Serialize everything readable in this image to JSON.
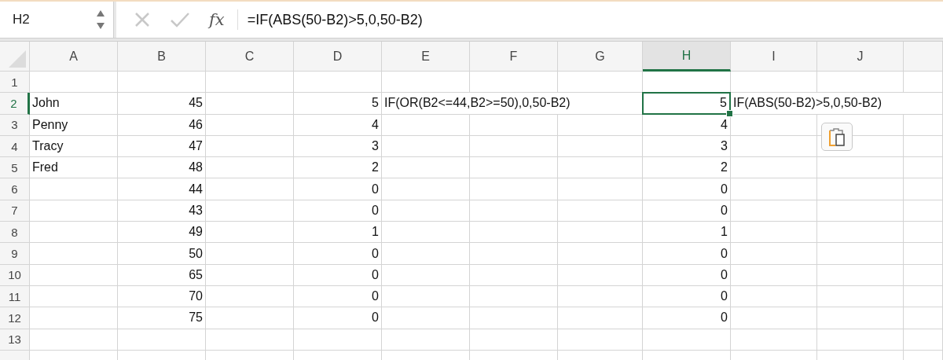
{
  "formula_bar": {
    "name_box": "H2",
    "fx_label": "fx",
    "formula": "=IF(ABS(50-B2)>5,0,50-B2)"
  },
  "columns": [
    {
      "label": "A",
      "selected": false
    },
    {
      "label": "B",
      "selected": false
    },
    {
      "label": "C",
      "selected": false
    },
    {
      "label": "D",
      "selected": false
    },
    {
      "label": "E",
      "selected": false
    },
    {
      "label": "F",
      "selected": false
    },
    {
      "label": "G",
      "selected": false
    },
    {
      "label": "H",
      "selected": true
    },
    {
      "label": "I",
      "selected": false
    },
    {
      "label": "J",
      "selected": false
    }
  ],
  "rows": [
    {
      "label": "1",
      "selected": false
    },
    {
      "label": "2",
      "selected": true,
      "cells": [
        {
          "value": "John",
          "kind": "text",
          "selected": false
        },
        {
          "value": "45",
          "kind": "number",
          "selected": false
        },
        {
          "kind": "empty",
          "selected": false
        },
        {
          "value": "5",
          "kind": "number",
          "selected": false
        },
        {
          "value": "IF(OR(B2<=44,B2>=50),0,50-B2)",
          "kind": "text",
          "selected": false
        },
        {
          "kind": "empty",
          "selected": false
        },
        {
          "kind": "empty",
          "selected": false
        },
        {
          "value": "5",
          "kind": "number",
          "selected": true
        },
        {
          "value": "IF(ABS(50-B2)>5,0,50-B2)",
          "kind": "text",
          "selected": false
        },
        {
          "kind": "empty",
          "selected": false
        }
      ]
    },
    {
      "label": "3",
      "selected": false,
      "cells": [
        {
          "value": "Penny",
          "kind": "text",
          "selected": false
        },
        {
          "value": "46",
          "kind": "number",
          "selected": false
        },
        {
          "kind": "empty",
          "selected": false
        },
        {
          "value": "4",
          "kind": "number",
          "selected": false
        },
        {
          "kind": "empty",
          "selected": false
        },
        {
          "kind": "empty",
          "selected": false
        },
        {
          "kind": "empty",
          "selected": false
        },
        {
          "value": "4",
          "kind": "number",
          "selected": false
        },
        {
          "kind": "empty",
          "selected": false
        },
        {
          "kind": "empty",
          "selected": false
        }
      ]
    },
    {
      "label": "4",
      "selected": false,
      "cells": [
        {
          "value": "Tracy",
          "kind": "text",
          "selected": false
        },
        {
          "value": "47",
          "kind": "number",
          "selected": false
        },
        {
          "kind": "empty",
          "selected": false
        },
        {
          "value": "3",
          "kind": "number",
          "selected": false
        },
        {
          "kind": "empty",
          "selected": false
        },
        {
          "kind": "empty",
          "selected": false
        },
        {
          "kind": "empty",
          "selected": false
        },
        {
          "value": "3",
          "kind": "number",
          "selected": false
        },
        {
          "kind": "empty",
          "selected": false
        },
        {
          "kind": "empty",
          "selected": false
        }
      ]
    },
    {
      "label": "5",
      "selected": false,
      "cells": [
        {
          "value": "Fred",
          "kind": "text",
          "selected": false
        },
        {
          "value": "48",
          "kind": "number",
          "selected": false
        },
        {
          "kind": "empty",
          "selected": false
        },
        {
          "value": "2",
          "kind": "number",
          "selected": false
        },
        {
          "kind": "empty",
          "selected": false
        },
        {
          "kind": "empty",
          "selected": false
        },
        {
          "kind": "empty",
          "selected": false
        },
        {
          "value": "2",
          "kind": "number",
          "selected": false
        },
        {
          "kind": "empty",
          "selected": false
        },
        {
          "kind": "empty",
          "selected": false
        }
      ]
    },
    {
      "label": "6",
      "selected": false,
      "cells": [
        {
          "kind": "empty",
          "selected": false
        },
        {
          "value": "44",
          "kind": "number",
          "selected": false
        },
        {
          "kind": "empty",
          "selected": false
        },
        {
          "value": "0",
          "kind": "number",
          "selected": false
        },
        {
          "kind": "empty",
          "selected": false
        },
        {
          "kind": "empty",
          "selected": false
        },
        {
          "kind": "empty",
          "selected": false
        },
        {
          "value": "0",
          "kind": "number",
          "selected": false
        },
        {
          "kind": "empty",
          "selected": false
        },
        {
          "kind": "empty",
          "selected": false
        }
      ]
    },
    {
      "label": "7",
      "selected": false,
      "cells": [
        {
          "kind": "empty",
          "selected": false
        },
        {
          "value": "43",
          "kind": "number",
          "selected": false
        },
        {
          "kind": "empty",
          "selected": false
        },
        {
          "value": "0",
          "kind": "number",
          "selected": false
        },
        {
          "kind": "empty",
          "selected": false
        },
        {
          "kind": "empty",
          "selected": false
        },
        {
          "kind": "empty",
          "selected": false
        },
        {
          "value": "0",
          "kind": "number",
          "selected": false
        },
        {
          "kind": "empty",
          "selected": false
        },
        {
          "kind": "empty",
          "selected": false
        }
      ]
    },
    {
      "label": "8",
      "selected": false,
      "cells": [
        {
          "kind": "empty",
          "selected": false
        },
        {
          "value": "49",
          "kind": "number",
          "selected": false
        },
        {
          "kind": "empty",
          "selected": false
        },
        {
          "value": "1",
          "kind": "number",
          "selected": false
        },
        {
          "kind": "empty",
          "selected": false
        },
        {
          "kind": "empty",
          "selected": false
        },
        {
          "kind": "empty",
          "selected": false
        },
        {
          "value": "1",
          "kind": "number",
          "selected": false
        },
        {
          "kind": "empty",
          "selected": false
        },
        {
          "kind": "empty",
          "selected": false
        }
      ]
    },
    {
      "label": "9",
      "selected": false,
      "cells": [
        {
          "kind": "empty",
          "selected": false
        },
        {
          "value": "50",
          "kind": "number",
          "selected": false
        },
        {
          "kind": "empty",
          "selected": false
        },
        {
          "value": "0",
          "kind": "number",
          "selected": false
        },
        {
          "kind": "empty",
          "selected": false
        },
        {
          "kind": "empty",
          "selected": false
        },
        {
          "kind": "empty",
          "selected": false
        },
        {
          "value": "0",
          "kind": "number",
          "selected": false
        },
        {
          "kind": "empty",
          "selected": false
        },
        {
          "kind": "empty",
          "selected": false
        }
      ]
    },
    {
      "label": "10",
      "selected": false,
      "cells": [
        {
          "kind": "empty",
          "selected": false
        },
        {
          "value": "65",
          "kind": "number",
          "selected": false
        },
        {
          "kind": "empty",
          "selected": false
        },
        {
          "value": "0",
          "kind": "number",
          "selected": false
        },
        {
          "kind": "empty",
          "selected": false
        },
        {
          "kind": "empty",
          "selected": false
        },
        {
          "kind": "empty",
          "selected": false
        },
        {
          "value": "0",
          "kind": "number",
          "selected": false
        },
        {
          "kind": "empty",
          "selected": false
        },
        {
          "kind": "empty",
          "selected": false
        }
      ]
    },
    {
      "label": "11",
      "selected": false,
      "cells": [
        {
          "kind": "empty",
          "selected": false
        },
        {
          "value": "70",
          "kind": "number",
          "selected": false
        },
        {
          "kind": "empty",
          "selected": false
        },
        {
          "value": "0",
          "kind": "number",
          "selected": false
        },
        {
          "kind": "empty",
          "selected": false
        },
        {
          "kind": "empty",
          "selected": false
        },
        {
          "kind": "empty",
          "selected": false
        },
        {
          "value": "0",
          "kind": "number",
          "selected": false
        },
        {
          "kind": "empty",
          "selected": false
        },
        {
          "kind": "empty",
          "selected": false
        }
      ]
    },
    {
      "label": "12",
      "selected": false,
      "cells": [
        {
          "kind": "empty",
          "selected": false
        },
        {
          "value": "75",
          "kind": "number",
          "selected": false
        },
        {
          "kind": "empty",
          "selected": false
        },
        {
          "value": "0",
          "kind": "number",
          "selected": false
        },
        {
          "kind": "empty",
          "selected": false
        },
        {
          "kind": "empty",
          "selected": false
        },
        {
          "kind": "empty",
          "selected": false
        },
        {
          "value": "0",
          "kind": "number",
          "selected": false
        },
        {
          "kind": "empty",
          "selected": false
        },
        {
          "kind": "empty",
          "selected": false
        }
      ]
    },
    {
      "label": "13",
      "selected": false
    }
  ]
}
